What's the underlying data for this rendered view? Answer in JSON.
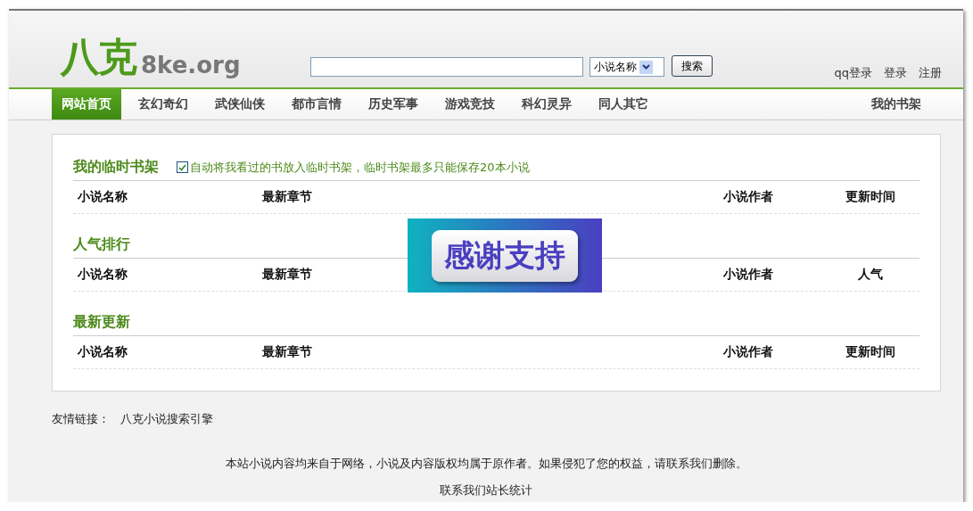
{
  "header": {
    "logo_cn": "八克",
    "logo_en": "8ke.org",
    "search_type": "小说名称",
    "search_button": "搜索",
    "links": [
      "qq登录",
      "登录",
      "注册"
    ]
  },
  "nav": {
    "items": [
      {
        "label": "网站首页",
        "selected": true
      },
      {
        "label": "玄幻奇幻",
        "selected": false
      },
      {
        "label": "武侠仙侠",
        "selected": false
      },
      {
        "label": "都市言情",
        "selected": false
      },
      {
        "label": "历史军事",
        "selected": false
      },
      {
        "label": "游戏竞技",
        "selected": false
      },
      {
        "label": "科幻灵异",
        "selected": false
      },
      {
        "label": "同人其它",
        "selected": false
      }
    ],
    "right": "我的书架"
  },
  "sections": [
    {
      "title": "我的临时书架",
      "option": {
        "label": "自动将我看过的书放入临时书架，临时书架最多只能保存20本小说",
        "checked": true
      },
      "columns": [
        "小说名称",
        "最新章节",
        "小说作者",
        "更新时间"
      ]
    },
    {
      "title": "人气排行",
      "columns": [
        "小说名称",
        "最新章节",
        "小说作者",
        "人气"
      ]
    },
    {
      "title": "最新更新",
      "columns": [
        "小说名称",
        "最新章节",
        "小说作者",
        "更新时间"
      ]
    }
  ],
  "overlay": {
    "text": "感谢支持"
  },
  "friend_links": {
    "label": "友情链接：",
    "links": [
      "八克小说搜索引擎"
    ]
  },
  "footer": {
    "notice": "本站小说内容均来自于网络，小说及内容版权均属于原作者。如果侵犯了您的权益，请联系我们删除。",
    "links": "联系我们站长统计"
  }
}
